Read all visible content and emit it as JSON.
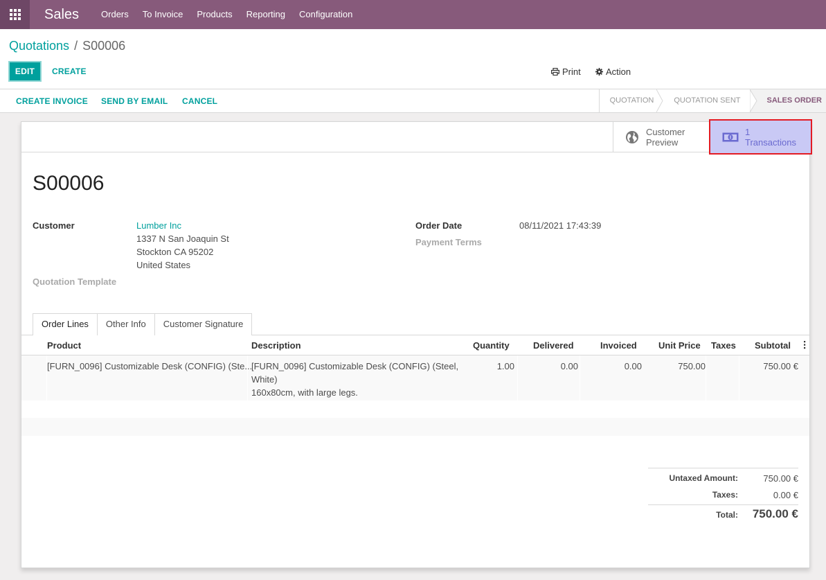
{
  "navbar": {
    "app_title": "Sales",
    "menu": [
      "Orders",
      "To Invoice",
      "Products",
      "Reporting",
      "Configuration"
    ]
  },
  "breadcrumb": {
    "parent": "Quotations",
    "separator": "/",
    "current": "S00006"
  },
  "buttons": {
    "edit": "EDIT",
    "create": "CREATE",
    "print": "Print",
    "action": "Action"
  },
  "statusbar": {
    "actions": [
      "CREATE INVOICE",
      "SEND BY EMAIL",
      "CANCEL"
    ],
    "stages": [
      "QUOTATION",
      "QUOTATION SENT",
      "SALES ORDER"
    ],
    "active_stage": "SALES ORDER"
  },
  "smart_buttons": {
    "customer_preview": {
      "line1": "Customer",
      "line2": "Preview",
      "icon": "globe-icon"
    },
    "transactions": {
      "line1": "1",
      "line2": "Transactions",
      "icon": "money-icon"
    }
  },
  "order": {
    "name": "S00006",
    "customer_label": "Customer",
    "customer_name": "Lumber Inc",
    "address": [
      "1337 N San Joaquin St",
      "Stockton CA 95202",
      "United States"
    ],
    "quotation_template_label": "Quotation Template",
    "order_date_label": "Order Date",
    "order_date": "08/11/2021 17:43:39",
    "payment_terms_label": "Payment Terms"
  },
  "tabs": [
    "Order Lines",
    "Other Info",
    "Customer Signature"
  ],
  "table": {
    "headers": [
      "Product",
      "Description",
      "Quantity",
      "Delivered",
      "Invoiced",
      "Unit Price",
      "Taxes",
      "Subtotal"
    ],
    "rows": [
      {
        "product": "[FURN_0096] Customizable Desk (CONFIG) (Ste...",
        "description": [
          "[FURN_0096] Customizable Desk (CONFIG) (Steel,",
          "White)",
          "160x80cm, with large legs."
        ],
        "quantity": "1.00",
        "delivered": "0.00",
        "invoiced": "0.00",
        "unit_price": "750.00",
        "taxes": "",
        "subtotal": "750.00 €"
      }
    ]
  },
  "totals": {
    "untaxed_label": "Untaxed Amount:",
    "untaxed_value": "750.00 €",
    "taxes_label": "Taxes:",
    "taxes_value": "0.00 €",
    "total_label": "Total:",
    "total_value": "750.00 €"
  },
  "colors": {
    "brand": "#875a7b",
    "accent": "#00a09d",
    "highlight_bg": "#c9c9f5",
    "highlight_border": "#e31b23"
  }
}
